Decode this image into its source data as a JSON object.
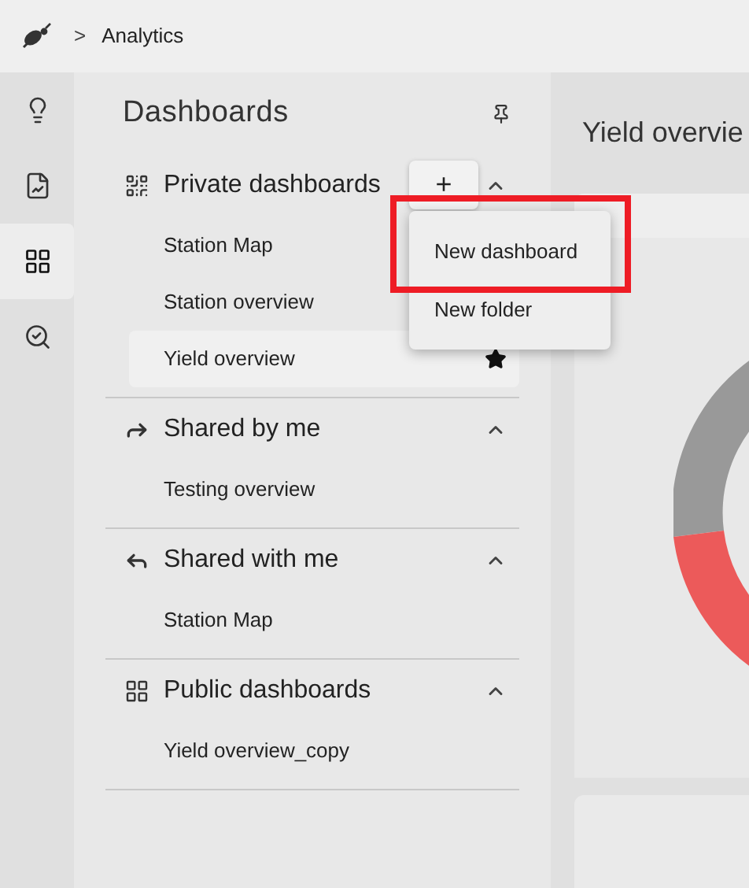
{
  "breadcrumb": {
    "separator": ">",
    "label": "Analytics"
  },
  "rail": [
    {
      "selected": false
    },
    {
      "selected": false
    },
    {
      "selected": true
    },
    {
      "selected": false
    }
  ],
  "panel": {
    "title": "Dashboards"
  },
  "sections": [
    {
      "title": "Private dashboards",
      "expanded": true,
      "add_button": "+",
      "items": [
        {
          "label": "Station Map",
          "selected": false,
          "starred": false
        },
        {
          "label": "Station overview",
          "selected": false,
          "starred": false
        },
        {
          "label": "Yield overview",
          "selected": true,
          "starred": true
        }
      ]
    },
    {
      "title": "Shared by me",
      "expanded": true,
      "items": [
        {
          "label": "Testing overview",
          "selected": false,
          "starred": false
        }
      ]
    },
    {
      "title": "Shared with me",
      "expanded": true,
      "items": [
        {
          "label": "Station Map",
          "selected": false,
          "starred": false
        }
      ]
    },
    {
      "title": "Public dashboards",
      "expanded": true,
      "items": [
        {
          "label": "Yield overview_copy",
          "selected": false,
          "starred": false
        }
      ]
    }
  ],
  "menu": {
    "items": [
      {
        "label": "New dashboard"
      },
      {
        "label": "New folder"
      }
    ]
  },
  "main": {
    "title": "Yield overvie"
  }
}
